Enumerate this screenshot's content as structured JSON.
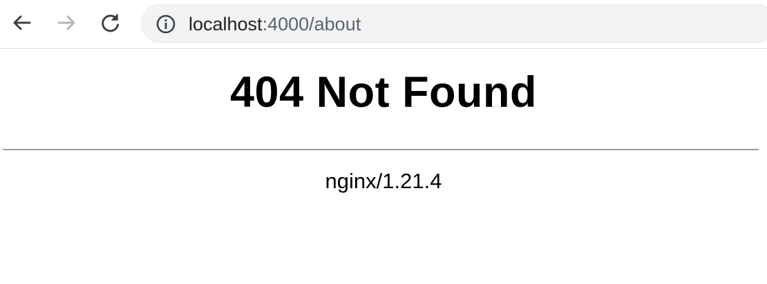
{
  "browser": {
    "url_host": "localhost",
    "url_rest": ":4000/about",
    "icons": {
      "back": "back-arrow-icon",
      "forward": "forward-arrow-icon",
      "reload": "reload-icon",
      "info": "info-icon"
    },
    "colors": {
      "icon_active": "#3c4043",
      "icon_disabled": "#b4b6b9",
      "omnibox_bg": "#f1f3f4"
    }
  },
  "page": {
    "heading": "404 Not Found",
    "server": "nginx/1.21.4"
  }
}
